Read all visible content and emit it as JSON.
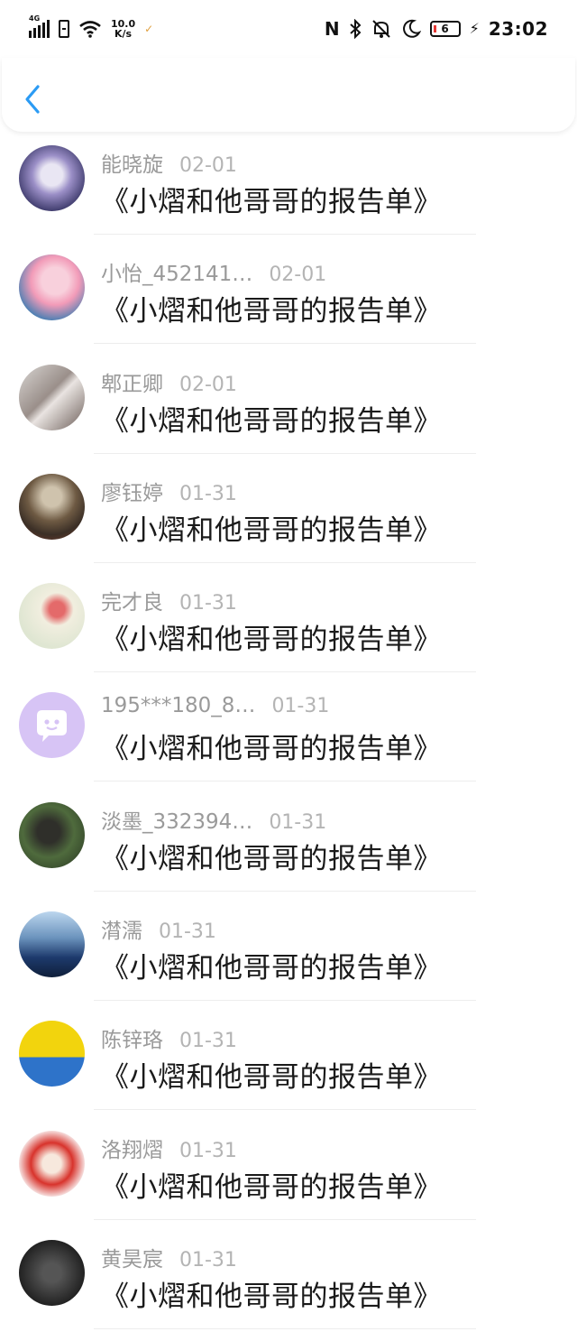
{
  "status_bar": {
    "network": "4G",
    "speed_value": "10.0",
    "speed_unit": "K/s",
    "battery": "6",
    "time": "23:02"
  },
  "header": {
    "back_icon": "chevron-left-icon",
    "accent_color": "#2b9bf4"
  },
  "rows": [
    {
      "name": "能晓旋",
      "date": "02-01",
      "title": "《小熠和他哥哥的报告单》",
      "avatar": "avatar-anime-blue"
    },
    {
      "name": "小怡_452141…",
      "date": "02-01",
      "title": "《小熠和他哥哥的报告单》",
      "avatar": "avatar-anime-pink"
    },
    {
      "name": "郫正卿",
      "date": "02-01",
      "title": "《小熠和他哥哥的报告单》",
      "avatar": "avatar-photo-gray"
    },
    {
      "name": "廖钰婷",
      "date": "01-31",
      "title": "《小熠和他哥哥的报告单》",
      "avatar": "avatar-anime-warrior"
    },
    {
      "name": "完才良",
      "date": "01-31",
      "title": "《小熠和他哥哥的报告单》",
      "avatar": "avatar-flower"
    },
    {
      "name": "195***180_8…",
      "date": "01-31",
      "title": "《小熠和他哥哥的报告单》",
      "avatar": "avatar-default-chat"
    },
    {
      "name": "淡墨_332394…",
      "date": "01-31",
      "title": "《小熠和他哥哥的报告单》",
      "avatar": "avatar-photo-girl"
    },
    {
      "name": "潸濡",
      "date": "01-31",
      "title": "《小熠和他哥哥的报告单》",
      "avatar": "avatar-car"
    },
    {
      "name": "陈锌珞",
      "date": "01-31",
      "title": "《小熠和他哥哥的报告单》",
      "avatar": "avatar-yellow-poster"
    },
    {
      "name": "洛翔熠",
      "date": "01-31",
      "title": "《小熠和他哥哥的报告单》",
      "avatar": "avatar-anime-red"
    },
    {
      "name": "黄昊宸",
      "date": "01-31",
      "title": "《小熠和他哥哥的报告单》",
      "avatar": "avatar-dark"
    }
  ]
}
